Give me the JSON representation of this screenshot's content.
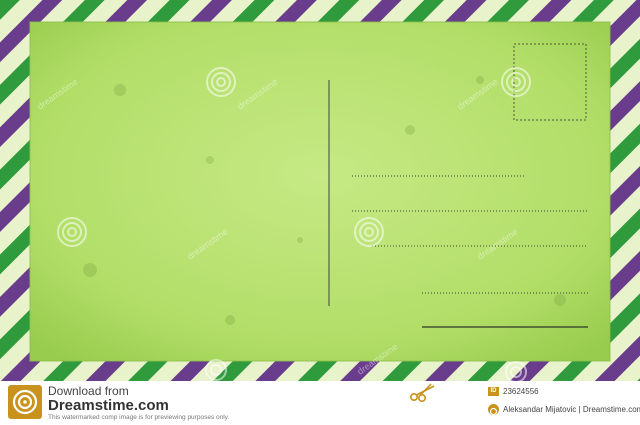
{
  "postcard": {
    "address_line_count": 4
  },
  "watermark": {
    "text": "dreamstime"
  },
  "footer": {
    "download_from": "Download from",
    "brand": "Dreamstime.com",
    "notice": "This watermarked comp image is for previewing purposes only.",
    "id_badge": "ID",
    "image_id": "23624556",
    "author": "Aleksandar Mijatovic | Dreamstime.com",
    "icons": [
      "dreamstime-logo-icon",
      "scissors-icon",
      "author-icon"
    ]
  },
  "colors": {
    "card": "#b4e069",
    "stripe_green": "#2f9b3c",
    "stripe_purple": "#6a3c8c",
    "stripe_light": "#e8f3cc",
    "accent": "#c8921c"
  }
}
